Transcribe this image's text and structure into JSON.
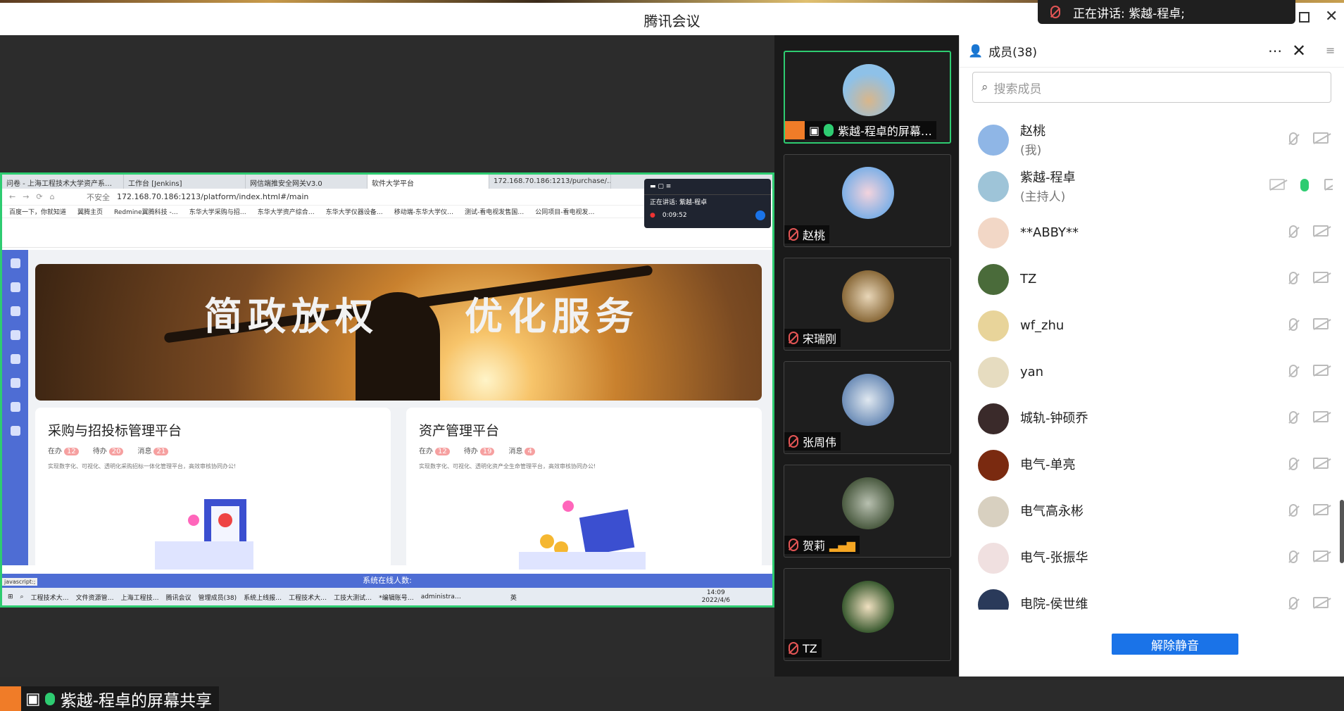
{
  "app": {
    "title": "腾讯会议",
    "speaking": "正在讲话: 紫越-程卓;"
  },
  "share": {
    "tabs": [
      "问卷 - 上海工程技术大学资产系…",
      "工作台 [Jenkins]",
      "网信端推安全网关V3.0",
      "软件大学平台",
      "172.168.70.186:1213/purchase/…"
    ],
    "address_prefix": "不安全",
    "address": "172.168.70.186:1213/platform/index.html#/main",
    "bookmarks": [
      "百度一下，你就知道",
      "翼腾主页",
      "Redmine翼腾科技 -…",
      "东华大学采购与招…",
      "东华大学资产综合…",
      "东华大学仪器设备…",
      "移动端-东华大学仪…",
      "测试-看电视发售国…",
      "公同项目-看电视发…"
    ],
    "banner_left": "简政放权",
    "banner_right": "优化服务",
    "cards": [
      {
        "title": "采购与招投标管理平台",
        "s1": "在办",
        "n1": "12",
        "s2": "待办",
        "n2": "20",
        "s3": "消息",
        "n3": "21",
        "desc": "实现数字化、可视化、透明化采购招标一体化管理平台，高效审核协同办公!"
      },
      {
        "title": "资产管理平台",
        "s1": "在办",
        "n1": "12",
        "s2": "待办",
        "n2": "19",
        "s3": "消息",
        "n3": "4",
        "desc": "实现数字化、可视化、透明化资产全生命管理平台，高效审核协同办公!"
      }
    ],
    "status": "系统在线人数:",
    "js": "javascript:;",
    "rec_speaking": "正在讲话: 紫越-程卓",
    "rec_time": "0:09:52",
    "taskbar": [
      "工程技术大…",
      "文件资源管…",
      "上海工程技…",
      "腾讯会议",
      "管理成员(38)",
      "系统上线报…",
      "工程技术大…",
      "工技大测试…",
      "*编辑账号…",
      "administra…"
    ],
    "lang": "英",
    "time": "14:09",
    "date": "2022/4/6"
  },
  "presenter": "紫越-程卓的屏幕共享",
  "videos": [
    "紫越-程卓的屏幕…",
    "赵桃",
    "宋瑞刚",
    "张周伟",
    "贺莉",
    "TZ"
  ],
  "panel": {
    "title": "成员(38)",
    "search_placeholder": "搜索成员",
    "members": [
      {
        "name": "赵桃",
        "sub": "(我)",
        "color": "#8fb6e6"
      },
      {
        "name": "紫越-程卓",
        "sub": "(主持人)",
        "color": "#9ec4d8"
      },
      {
        "name": "**ABBY**",
        "sub": "",
        "color": "#f2d7c6"
      },
      {
        "name": "TZ",
        "sub": "",
        "color": "#4a6b3a"
      },
      {
        "name": "wf_zhu",
        "sub": "",
        "color": "#e8d49a"
      },
      {
        "name": "yan",
        "sub": "",
        "color": "#e6dcc0"
      },
      {
        "name": "城轨-钟硕乔",
        "sub": "",
        "color": "#3a2a2a"
      },
      {
        "name": "电气-单亮",
        "sub": "",
        "color": "#7a2a10"
      },
      {
        "name": "电气高永彬",
        "sub": "",
        "color": "#d8d0c0"
      },
      {
        "name": "电气-张振华",
        "sub": "",
        "color": "#f0e0e0"
      },
      {
        "name": "电院-侯世维",
        "sub": "",
        "color": "#2a3a5a"
      }
    ],
    "unmute": "解除静音"
  }
}
